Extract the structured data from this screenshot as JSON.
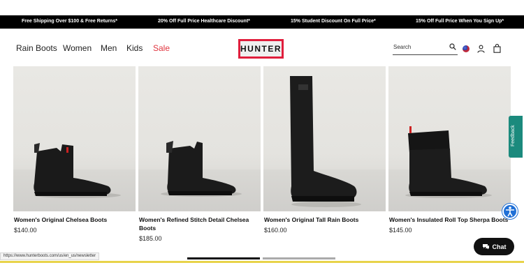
{
  "promo": [
    "Free Shipping Over $100 & Free Returns*",
    "20% Off Full Price Healthcare Discount*",
    "15% Student Discount On Full Price*",
    "15% Off Full Price When You Sign Up*"
  ],
  "nav": {
    "rain_boots": "Rain Boots",
    "women": "Women",
    "men": "Men",
    "kids": "Kids",
    "sale": "Sale"
  },
  "logo": "HUNTER",
  "search": {
    "placeholder": "Search"
  },
  "products": [
    {
      "name": "Women's Original Chelsea Boots",
      "price": "$140.00"
    },
    {
      "name": "Women's Refined Stitch Detail Chelsea Boots",
      "price": "$185.00"
    },
    {
      "name": "Women's Original Tall Rain Boots",
      "price": "$160.00"
    },
    {
      "name": "Women's Insulated Roll Top Sherpa Boots",
      "price": "$145.00"
    }
  ],
  "feedback_label": "Feedback",
  "chat_label": "Chat",
  "status_url": "https://www.hunterboots.com/us/en_us/newsletter",
  "colors": {
    "accent": "#e0353f",
    "logo_border": "#e01e3c",
    "feedback": "#1b8a7d",
    "accessibility": "#1f6fd6"
  }
}
